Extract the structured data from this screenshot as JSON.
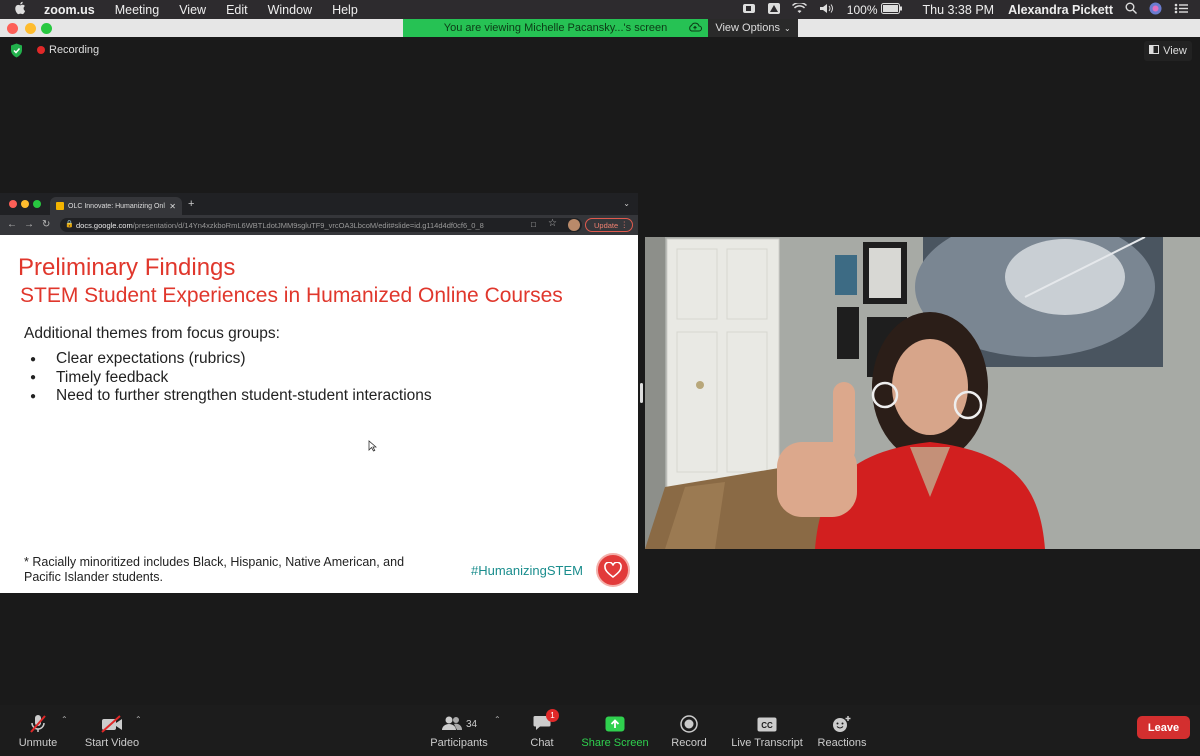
{
  "menubar": {
    "app": "zoom.us",
    "items": [
      "Meeting",
      "View",
      "Edit",
      "Window",
      "Help"
    ],
    "battery": "100%",
    "clock": "Thu 3:38 PM",
    "user": "Alexandra Pickett"
  },
  "window": {
    "viewing_banner": "You are viewing Michelle Pacansky...'s screen",
    "view_options": "View Options",
    "recording_label": "Recording",
    "view_button": "View"
  },
  "browser": {
    "tab_title": "OLC Innovate: Humanizing Onl",
    "url_host": "docs.google.com",
    "url_path": "/presentation/d/14Yn4xzkboRmL6WBTLdotJMM9sgluTF9_vrcOA3LbcoM/edit#slide=id.g114d4df0cf6_0_8",
    "update_label": "Update"
  },
  "slide": {
    "title": "Preliminary Findings",
    "subtitle": "STEM Student Experiences in Humanized Online Courses",
    "intro": "Additional themes from focus groups:",
    "bullets": [
      "Clear expectations (rubrics)",
      "Timely feedback",
      "Need to further strengthen student-student interactions"
    ],
    "footnote_line1": "* Racially minoritized includes Black, Hispanic, Native American, and",
    "footnote_line2": "Pacific Islander students.",
    "hashtag": "#HumanizingSTEM"
  },
  "toolbar": {
    "unmute": "Unmute",
    "start_video": "Start Video",
    "participants": "Participants",
    "participants_count": "34",
    "chat": "Chat",
    "chat_badge": "1",
    "share_screen": "Share Screen",
    "record": "Record",
    "live_transcript": "Live Transcript",
    "reactions": "Reactions",
    "leave": "Leave"
  },
  "colors": {
    "zoom_green": "#26c254",
    "slide_red": "#e0372c",
    "hashtag_teal": "#1a8d8d",
    "leave_red": "#d32f2f"
  }
}
